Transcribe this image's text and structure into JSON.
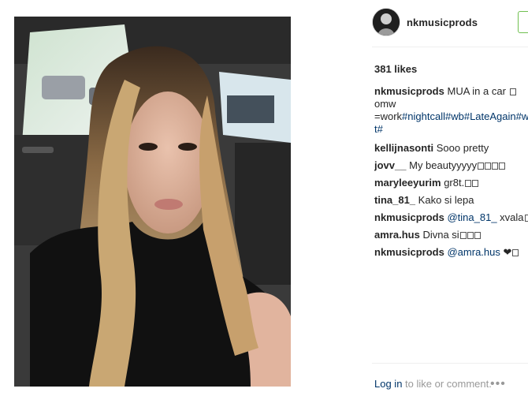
{
  "post": {
    "username": "nkmusicprods",
    "likes": "381 likes",
    "caption_line1": "MUA in a car ",
    "caption_line2_prefix": "=work",
    "caption_tags": [
      "#nightcall",
      "#wb",
      "#LateAgain",
      "#w"
    ],
    "caption_line3": "t#",
    "caption_fragment": "omw"
  },
  "comments": [
    {
      "user": "kellijnasonti",
      "text": "Sooo pretty"
    },
    {
      "user": "jovv__",
      "text": "My beautyyyyy"
    },
    {
      "user": "maryleeyurim",
      "text": "gr8t."
    },
    {
      "user": "tina_81_",
      "text": "Kako si lepa"
    },
    {
      "user": "nkmusicprods",
      "mention": "@tina_81_",
      "text": " xvala",
      "suffix": "ta"
    },
    {
      "user": "amra.hus",
      "text": "Divna si"
    },
    {
      "user": "nkmusicprods",
      "mention": "@amra.hus",
      "text": " ❤"
    }
  ],
  "footer": {
    "login_link": "Log in",
    "login_rest": " to like or comment.",
    "more_icon": "more-dots-icon"
  },
  "colors": {
    "accent_link": "#003569",
    "follow_border": "#70c050",
    "muted": "#999999"
  }
}
